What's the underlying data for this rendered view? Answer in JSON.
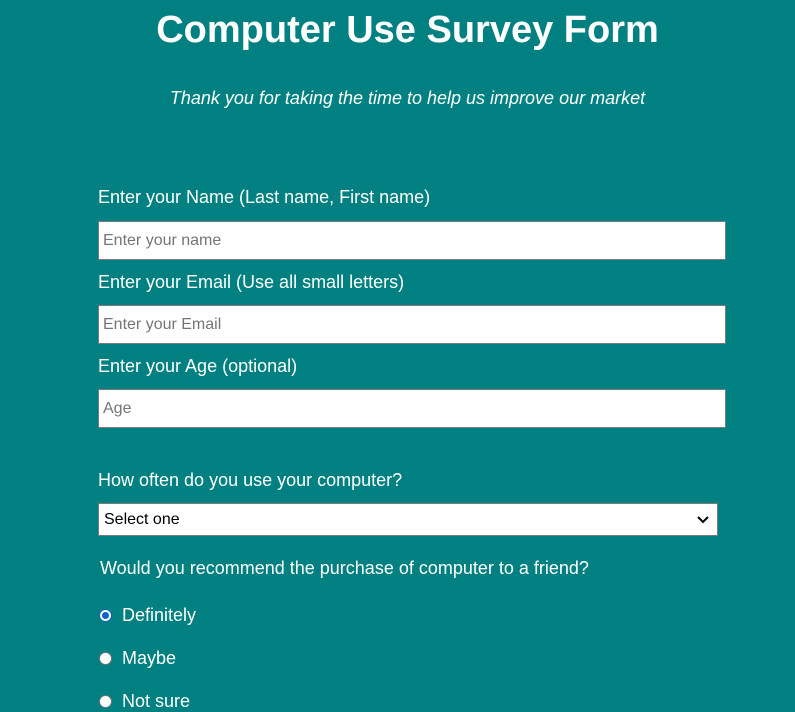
{
  "header": {
    "title": "Computer Use Survey Form",
    "description": "Thank you for taking the time to help us improve our market"
  },
  "form": {
    "name": {
      "label": "Enter your Name (Last name, First name)",
      "placeholder": "Enter your name",
      "value": ""
    },
    "email": {
      "label": "Enter your Email (Use all small letters)",
      "placeholder": "Enter your Email",
      "value": ""
    },
    "age": {
      "label": "Enter your Age (optional)",
      "placeholder": "Age",
      "value": ""
    },
    "frequency": {
      "label": "How often do you use your computer?",
      "selected": "Select one"
    },
    "recommend": {
      "label": "Would you recommend the purchase of computer to a friend?",
      "options": [
        {
          "label": "Definitely",
          "checked": true
        },
        {
          "label": "Maybe",
          "checked": false
        },
        {
          "label": "Not sure",
          "checked": false
        }
      ]
    }
  },
  "colors": {
    "background": "#008080",
    "text": "#ffffff",
    "radio_accent": "#0b63d1"
  }
}
